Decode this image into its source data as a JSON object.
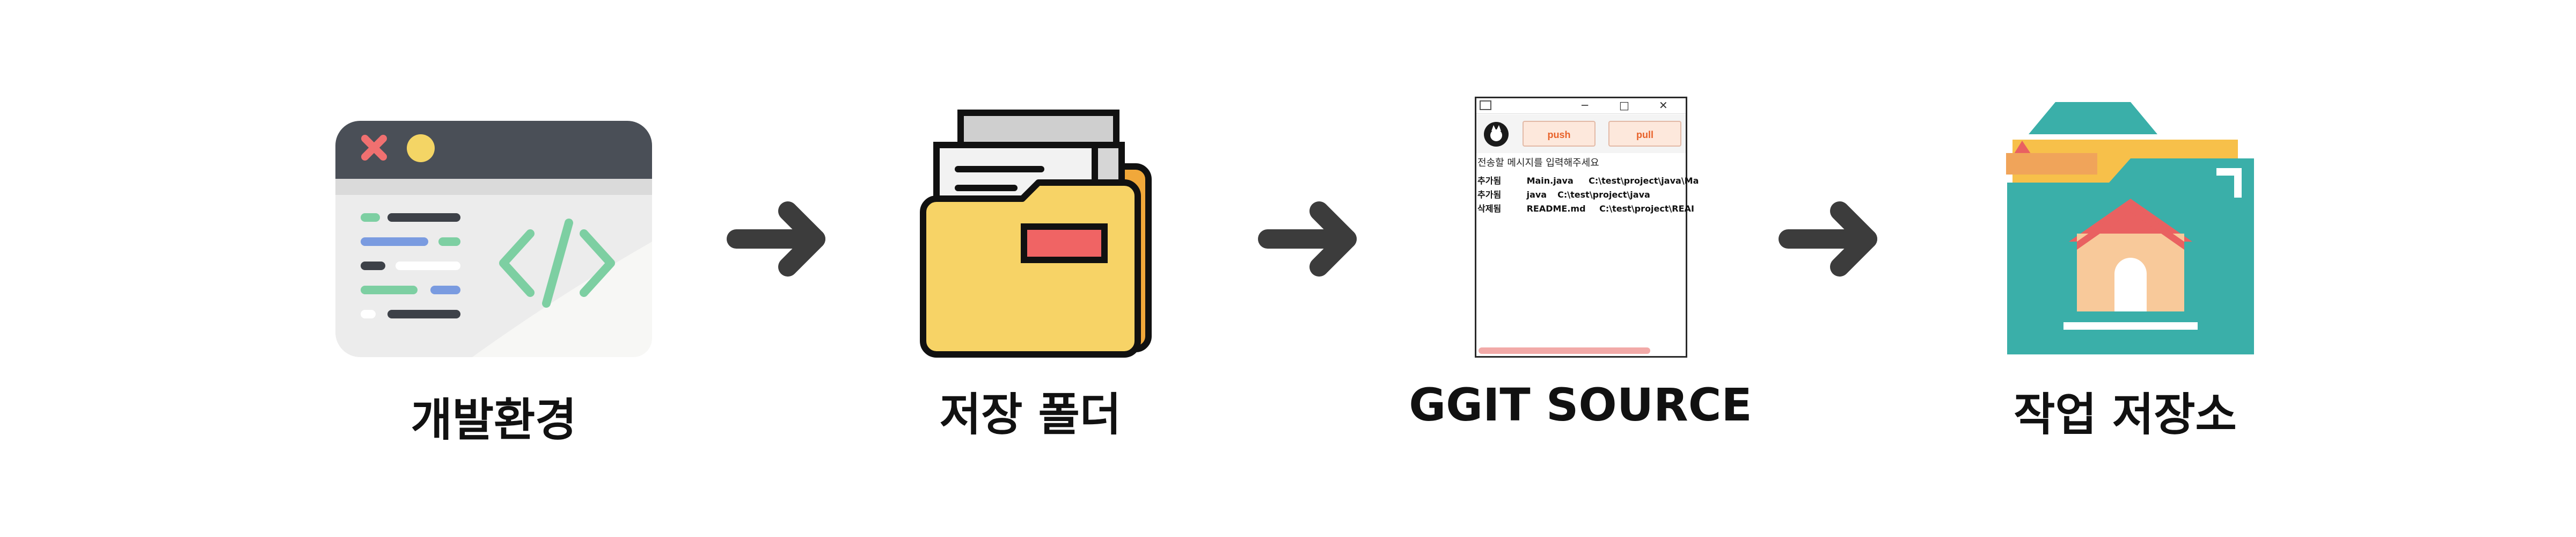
{
  "steps": [
    {
      "id": "dev-env",
      "label": "개발환경",
      "icon": "code-window-icon"
    },
    {
      "id": "save-folder",
      "label": "저장 폴더",
      "icon": "folder-icon"
    },
    {
      "id": "ggit-source",
      "label": "GGIT SOURCE",
      "icon": "app-window-icon"
    },
    {
      "id": "repository",
      "label": "작업 저장소",
      "icon": "home-folder-icon"
    }
  ],
  "connectors": [
    "arrow-right-icon",
    "arrow-right-icon",
    "arrow-right-icon"
  ],
  "app_window": {
    "title_icon": "app-logo-icon",
    "controls": [
      "─",
      "□",
      "✕"
    ],
    "push_label": "push",
    "pull_label": "pull",
    "hint": "전송할 메시지를 입력해주세요",
    "rows": [
      {
        "status": "추가됨",
        "file": "Main.java",
        "path": "C:\\test\\project\\java\\Ma"
      },
      {
        "status": "추가됨",
        "file": "java",
        "path": "C:\\test\\project\\java"
      },
      {
        "status": "삭제됨",
        "file": "README.md",
        "path": "C:\\test\\project\\REAI"
      }
    ]
  },
  "colors": {
    "arrow": "#3c3c3c",
    "folder_yellow": "#f7d366",
    "teal": "#3aafa9",
    "window_dark": "#4a4f57",
    "code_green": "#7dcfa2",
    "code_blue": "#7a9be0"
  }
}
